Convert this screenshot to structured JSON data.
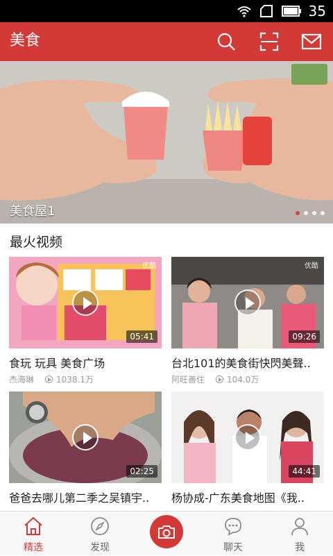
{
  "status_bar": {
    "time": "35",
    "icons": [
      "wifi-icon",
      "sim-icon",
      "battery-icon"
    ]
  },
  "app_bar": {
    "title": "美食",
    "icons": [
      "search-icon",
      "scan-icon",
      "mail-icon"
    ]
  },
  "banner": {
    "caption": "美食屋1",
    "slide_count": 4,
    "active_slide": 1
  },
  "section": {
    "title": "最火视频"
  },
  "videos": [
    {
      "title": "食玩 玩具 美食广场",
      "author": "杰海琳",
      "plays": "1038.1万",
      "duration": "05:41",
      "watermark": "优酷"
    },
    {
      "title": "台北101的美食街快閃美聲..",
      "author": "阿旺善住",
      "plays": "104.0万",
      "duration": "09:26",
      "watermark": "优酷"
    },
    {
      "title": "爸爸去哪儿第二季之吴镇宇..",
      "author": "",
      "plays": "",
      "duration": "02:25",
      "watermark": ""
    },
    {
      "title": "杨协成-广东美食地图《我..",
      "author": "",
      "plays": "",
      "duration": "44:41",
      "watermark": ""
    }
  ],
  "tabs": [
    {
      "label": "精选",
      "icon": "home-icon",
      "active": true
    },
    {
      "label": "发现",
      "icon": "compass-icon",
      "active": false
    },
    {
      "label": "聊天",
      "icon": "chat-icon",
      "active": false
    },
    {
      "label": "我",
      "icon": "person-icon",
      "active": false
    }
  ],
  "colors": {
    "brand": "#d33a37",
    "tab_bar": "#f8f8f8"
  }
}
